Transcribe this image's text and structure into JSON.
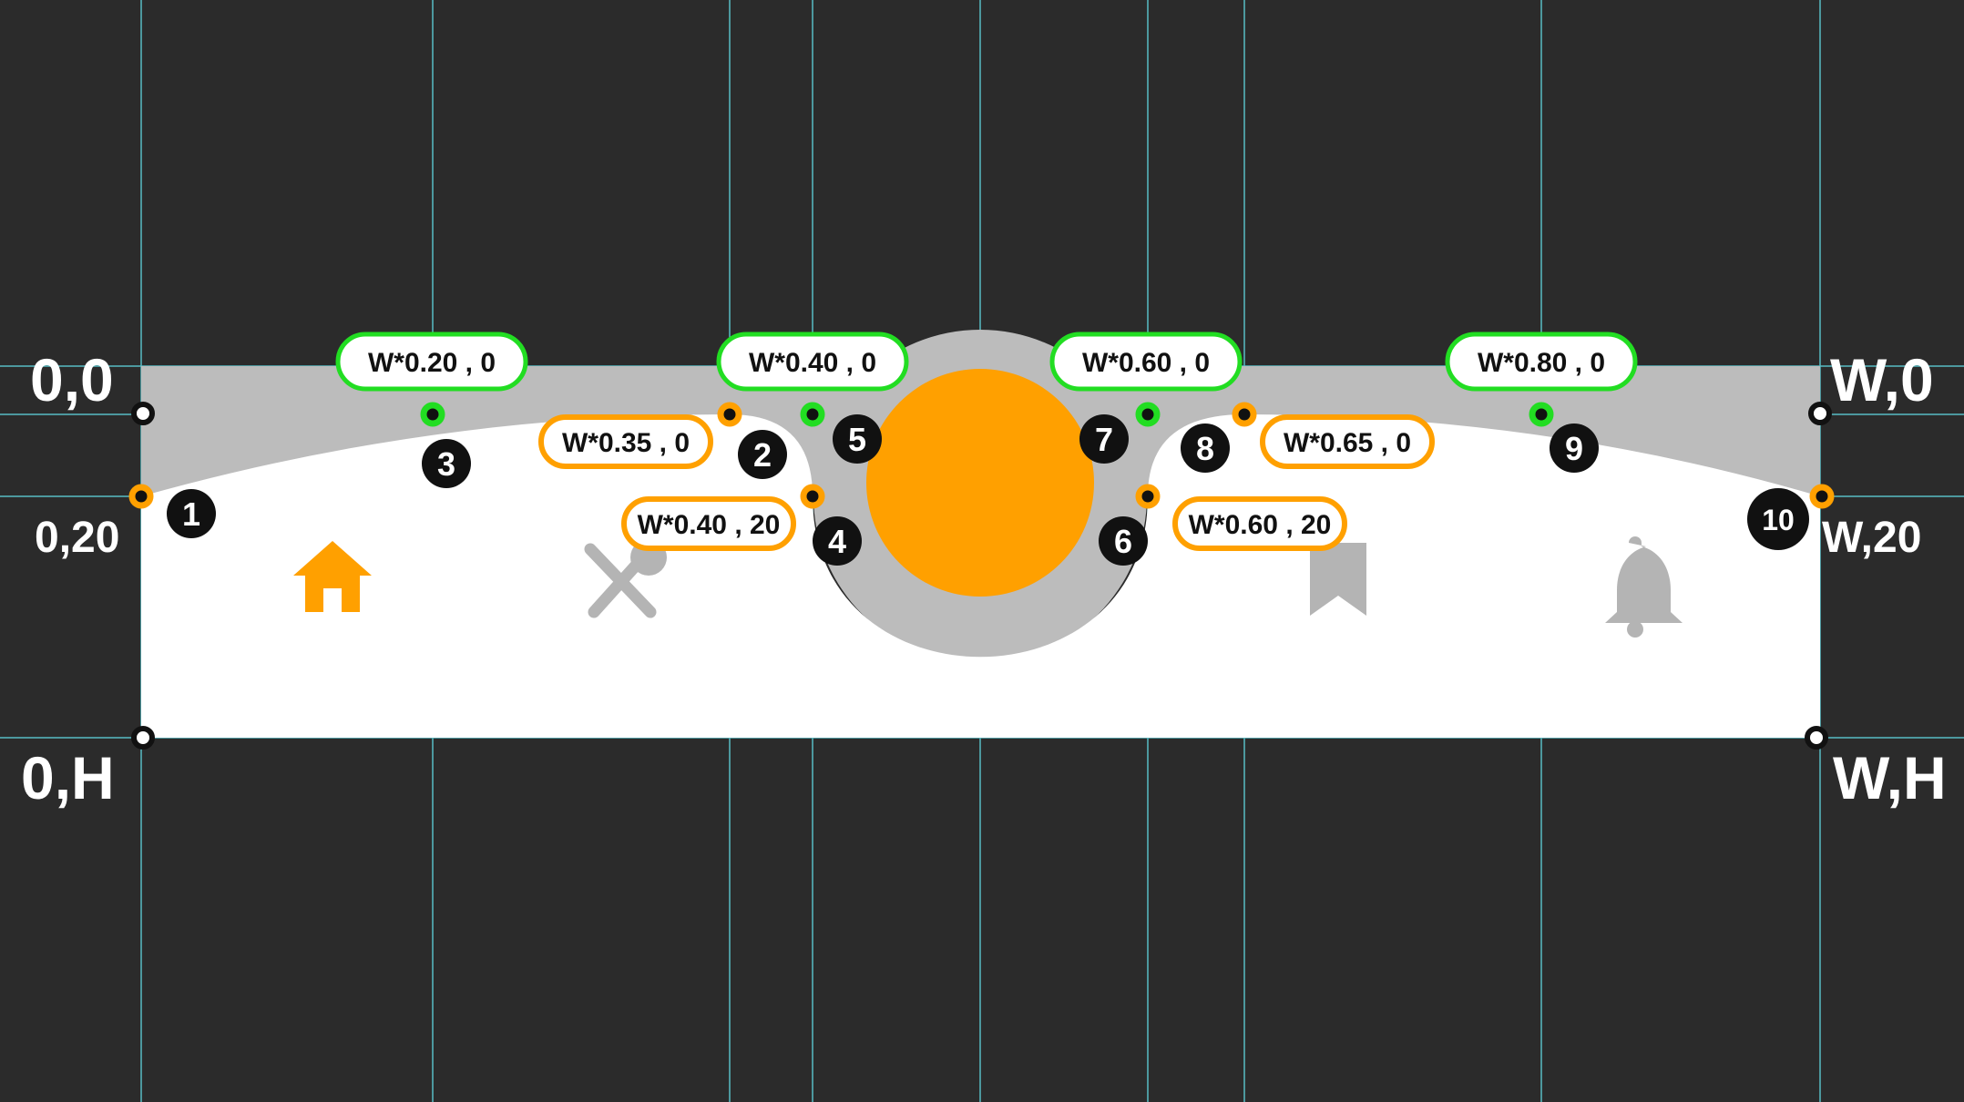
{
  "colors": {
    "background": "#2b2b2b",
    "guide": "#5fd6df",
    "bar_fill": "#ffffff",
    "cutout_gray": "#bcbcbc",
    "accent_orange": "#ffa000",
    "active_green": "#22dd22",
    "icon_inactive": "#b4b4b4",
    "badge": "#111111"
  },
  "corner_labels": {
    "top_left": "0,0",
    "left_20": "0,20",
    "bottom_left": "0,H",
    "top_right": "W,0",
    "right_20": "W,20",
    "bottom_right": "W,H"
  },
  "green_labels": [
    "W*0.20 , 0",
    "W*0.40 , 0",
    "W*0.60 , 0",
    "W*0.80 , 0"
  ],
  "orange_labels": [
    "W*0.35 , 0",
    "W*0.40 , 20",
    "W*0.60 , 20",
    "W*0.65 , 0"
  ],
  "point_numbers": [
    "1",
    "2",
    "3",
    "4",
    "5",
    "6",
    "7",
    "8",
    "9",
    "10"
  ],
  "nav_icons": [
    {
      "name": "home-icon",
      "active": true
    },
    {
      "name": "utensils-icon",
      "active": false
    },
    {
      "name": "bookmark-icon",
      "active": false
    },
    {
      "name": "bell-icon",
      "active": false
    }
  ],
  "center_button": {
    "name": "center-circle-button",
    "color": "#ffa000"
  }
}
